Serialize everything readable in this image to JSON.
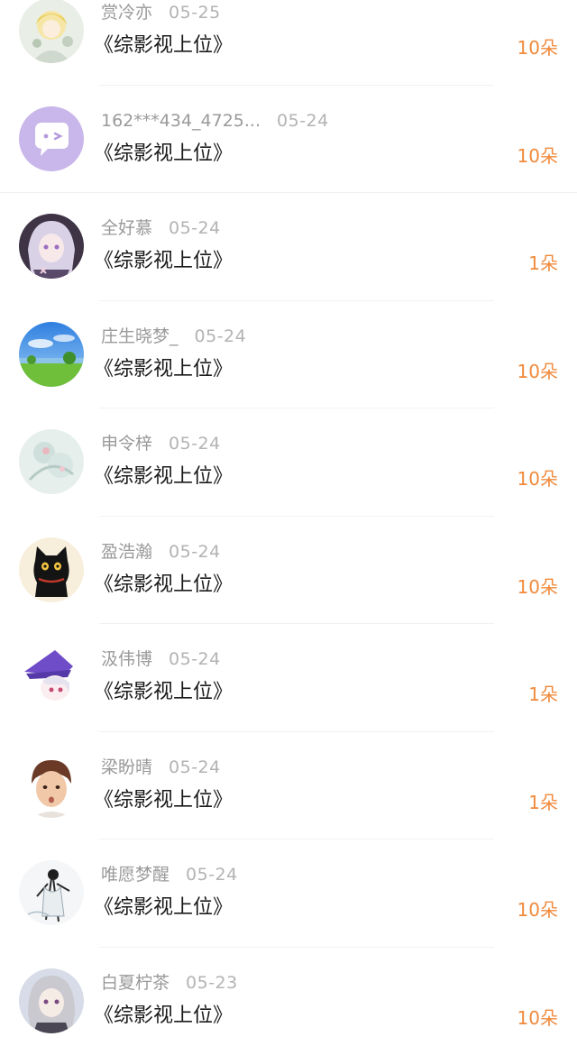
{
  "list": {
    "items": [
      {
        "name": "赏冷亦",
        "date": "05-25",
        "title": "《综影视上位》",
        "count": "10朵",
        "avatar": "anime-blonde-avatar"
      },
      {
        "name": "162***434_4725...",
        "date": "05-24",
        "title": "《综影视上位》",
        "count": "10朵",
        "avatar": "chat-bubble-avatar"
      },
      {
        "name": "全好慕",
        "date": "05-24",
        "title": "《综影视上位》",
        "count": "1朵",
        "avatar": "anime-silver-hair-avatar"
      },
      {
        "name": "庄生晓梦_",
        "date": "05-24",
        "title": "《综影视上位》",
        "count": "10朵",
        "avatar": "landscape-avatar"
      },
      {
        "name": "申令梓",
        "date": "05-24",
        "title": "《综影视上位》",
        "count": "10朵",
        "avatar": "watercolor-flower-avatar"
      },
      {
        "name": "盈浩瀚",
        "date": "05-24",
        "title": "《综影视上位》",
        "count": "10朵",
        "avatar": "black-cat-avatar"
      },
      {
        "name": "汲伟博",
        "date": "05-24",
        "title": "《综影视上位》",
        "count": "1朵",
        "avatar": "anime-purple-hat-avatar"
      },
      {
        "name": "梁盼晴",
        "date": "05-24",
        "title": "《综影视上位》",
        "count": "1朵",
        "avatar": "boy-portrait-avatar"
      },
      {
        "name": "唯愿梦醒",
        "date": "05-24",
        "title": "《综影视上位》",
        "count": "10朵",
        "avatar": "ink-figure-avatar"
      },
      {
        "name": "白夏柠茶",
        "date": "05-23",
        "title": "《综影视上位》",
        "count": "10朵",
        "avatar": "anime-white-hair-avatar"
      }
    ]
  },
  "colors": {
    "accent": "#f08a3c",
    "name_text": "#9a9a9a",
    "title_text": "#1a1a1a",
    "divider": "#f2f2f2"
  }
}
